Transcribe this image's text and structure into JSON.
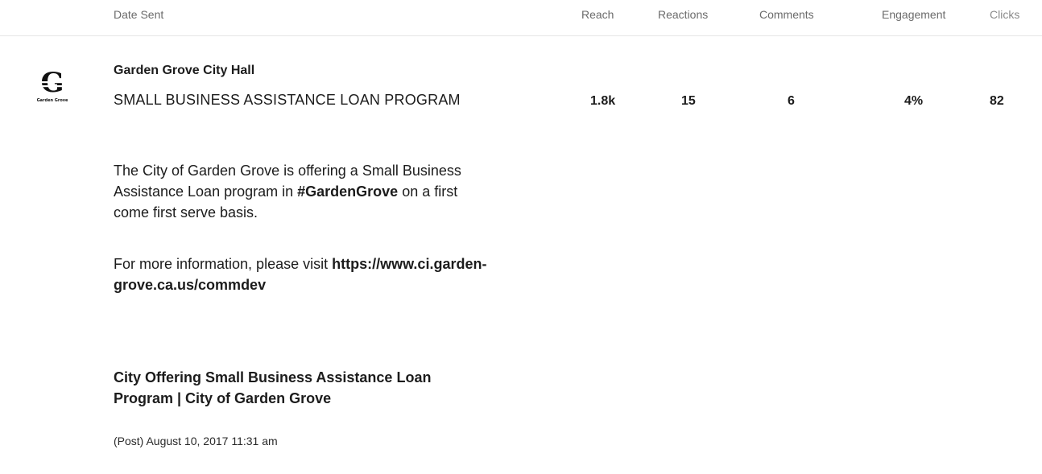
{
  "header": {
    "date_sent": "Date Sent",
    "reach": "Reach",
    "reactions": "Reactions",
    "comments": "Comments",
    "engagement": "Engagement",
    "clicks": "Clicks"
  },
  "post": {
    "account_name": "Garden Grove City Hall",
    "logo_text": "Garden Grove",
    "headline": "SMALL BUSINESS ASSISTANCE LOAN PROGRAM",
    "body_intro": "The City of Garden Grove is offering a Small Business Assistance Loan program in ",
    "hashtag": "#GardenGrove",
    "body_rest": " on a first come first serve basis.",
    "info_text": "For more information, please visit ",
    "url": "https://www.ci.garden-grove.ca.us/commdev",
    "link_title": "City Offering Small Business Assistance Loan Program | City of Garden Grove",
    "posted": "(Post) August 10, 2017 11:31 am",
    "metrics": {
      "reach": "1.8k",
      "reactions": "15",
      "comments": "6",
      "engagement": "4%",
      "clicks": "82"
    }
  }
}
